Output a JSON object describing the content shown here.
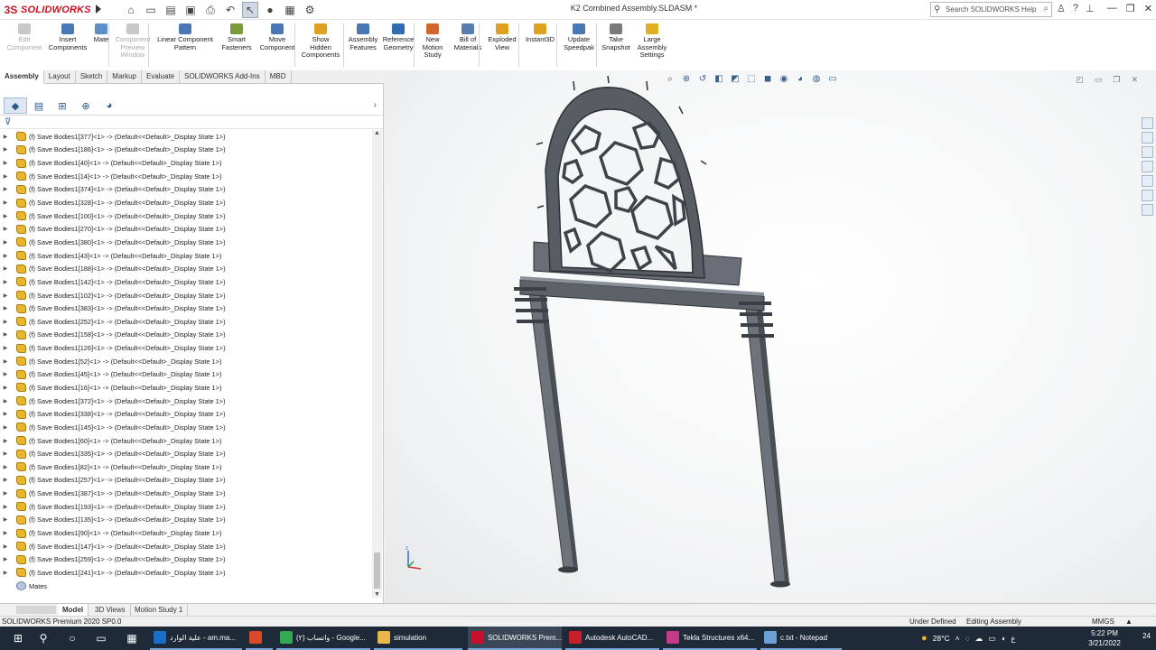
{
  "app": {
    "logo_mark": "3S",
    "logo_text": "SOLIDWORKS",
    "document_title": "K2 Combined Assembly.SLDASM *",
    "search_placeholder": "Search SOLIDWORKS Help"
  },
  "quick_access": [
    "home-icon",
    "new-icon",
    "open-icon",
    "save-icon",
    "print-icon",
    "undo-icon",
    "select-icon",
    "rebuild-icon",
    "file-props-icon",
    "options-icon"
  ],
  "command_manager": [
    {
      "label": "Edit\nComponent",
      "disabled": true,
      "color": "#c8c8c8"
    },
    {
      "label": "Insert\nComponents",
      "disabled": false,
      "color": "#4a78b5"
    },
    {
      "label": "Mate",
      "disabled": false,
      "color": "#5a8fc7"
    },
    {
      "label": "Component\nPreview\nWindow",
      "disabled": true,
      "color": "#c8c8c8"
    },
    {
      "label": "Linear Component\nPattern",
      "disabled": false,
      "color": "#4a78b5"
    },
    {
      "label": "Smart\nFasteners",
      "disabled": false,
      "color": "#7a9a3b"
    },
    {
      "label": "Move\nComponent",
      "disabled": false,
      "color": "#4a78b5"
    },
    {
      "label": "Show\nHidden\nComponents",
      "disabled": false,
      "color": "#e0a020"
    },
    {
      "label": "Assembly\nFeatures",
      "disabled": false,
      "color": "#4a78b5"
    },
    {
      "label": "Reference\nGeometry",
      "disabled": false,
      "color": "#2f6cb0"
    },
    {
      "label": "New\nMotion\nStudy",
      "disabled": false,
      "color": "#d0662a"
    },
    {
      "label": "Bill of\nMaterials",
      "disabled": false,
      "color": "#5a7db0"
    },
    {
      "label": "Exploded\nView",
      "disabled": false,
      "color": "#e0a020"
    },
    {
      "label": "Instant3D",
      "disabled": false,
      "color": "#e0a020"
    },
    {
      "label": "Update\nSpeedpak",
      "disabled": false,
      "color": "#4a78b5"
    },
    {
      "label": "Take\nSnapshot",
      "disabled": false,
      "color": "#7a7a7a"
    },
    {
      "label": "Large\nAssembly\nSettings",
      "disabled": false,
      "color": "#e0b020"
    }
  ],
  "command_tabs": [
    "Assembly",
    "Layout",
    "Sketch",
    "Markup",
    "Evaluate",
    "SOLIDWORKS Add-Ins",
    "MBD"
  ],
  "active_command_tab": "Assembly",
  "tree": {
    "items": [
      "(f) Save Bodies1[377]<1> -> (Default<<Default>_Display State 1>)",
      "(f) Save Bodies1[186]<1> -> (Default<<Default>_Display State 1>)",
      "(f) Save Bodies1[40]<1> -> (Default<<Default>_Display State 1>)",
      "(f) Save Bodies1[14]<1> -> (Default<<Default>_Display State 1>)",
      "(f) Save Bodies1[374]<1> -> (Default<<Default>_Display State 1>)",
      "(f) Save Bodies1[328]<1> -> (Default<<Default>_Display State 1>)",
      "(f) Save Bodies1[100]<1> -> (Default<<Default>_Display State 1>)",
      "(f) Save Bodies1[270]<1> -> (Default<<Default>_Display State 1>)",
      "(f) Save Bodies1[380]<1> -> (Default<<Default>_Display State 1>)",
      "(f) Save Bodies1[43]<1> -> (Default<<Default>_Display State 1>)",
      "(f) Save Bodies1[188]<1> -> (Default<<Default>_Display State 1>)",
      "(f) Save Bodies1[142]<1> -> (Default<<Default>_Display State 1>)",
      "(f) Save Bodies1[102]<1> -> (Default<<Default>_Display State 1>)",
      "(f) Save Bodies1[383]<1> -> (Default<<Default>_Display State 1>)",
      "(f) Save Bodies1[252]<1> -> (Default<<Default>_Display State 1>)",
      "(f) Save Bodies1[158]<1> -> (Default<<Default>_Display State 1>)",
      "(f) Save Bodies1[126]<1> -> (Default<<Default>_Display State 1>)",
      "(f) Save Bodies1[52]<1> -> (Default<<Default>_Display State 1>)",
      "(f) Save Bodies1[45]<1> -> (Default<<Default>_Display State 1>)",
      "(f) Save Bodies1[16]<1> -> (Default<<Default>_Display State 1>)",
      "(f) Save Bodies1[372]<1> -> (Default<<Default>_Display State 1>)",
      "(f) Save Bodies1[338]<1> -> (Default<<Default>_Display State 1>)",
      "(f) Save Bodies1[145]<1> -> (Default<<Default>_Display State 1>)",
      "(f) Save Bodies1[60]<1> -> (Default<<Default>_Display State 1>)",
      "(f) Save Bodies1[335]<1> -> (Default<<Default>_Display State 1>)",
      "(f) Save Bodies1[82]<1> -> (Default<<Default>_Display State 1>)",
      "(f) Save Bodies1[257]<1> -> (Default<<Default>_Display State 1>)",
      "(f) Save Bodies1[387]<1> -> (Default<<Default>_Display State 1>)",
      "(f) Save Bodies1[193]<1> -> (Default<<Default>_Display State 1>)",
      "(f) Save Bodies1[135]<1> -> (Default<<Default>_Display State 1>)",
      "(f) Save Bodies1[90]<1> -> (Default<<Default>_Display State 1>)",
      "(f) Save Bodies1[147]<1> -> (Default<<Default>_Display State 1>)",
      "(f) Save Bodies1[259]<1> -> (Default<<Default>_Display State 1>)",
      "(f) Save Bodies1[241]<1> -> (Default<<Default>_Display State 1>)"
    ],
    "mates_label": "Mates"
  },
  "bottom_tabs": [
    "Model",
    "3D Views",
    "Motion Study 1"
  ],
  "active_bottom_tab": "Model",
  "status": {
    "product": "SOLIDWORKS Premium 2020 SP0.0",
    "under_defined": "Under Defined",
    "editing": "Editing Assembly",
    "units": "MMGS",
    "units_arrow": "▲"
  },
  "taskbar": {
    "apps": [
      {
        "label": "علية الوارد - am.ma...",
        "color": "#1a6fc9",
        "active": false
      },
      {
        "label": "",
        "color": "#d84a2a",
        "active": false
      },
      {
        "label": "واتساب (٢) - Google...",
        "color": "#34a853",
        "active": false
      },
      {
        "label": "simulation",
        "color": "#e8b84a",
        "active": false
      },
      {
        "label": "SOLIDWORKS Prem...",
        "color": "#c8102e",
        "active": true
      },
      {
        "label": "Autodesk AutoCAD...",
        "color": "#c8202a",
        "active": false
      },
      {
        "label": "Tekla Structures x64...",
        "color": "#c63a8a",
        "active": false
      },
      {
        "label": "c.txt - Notepad",
        "color": "#6aa0d8",
        "active": false
      }
    ],
    "temperature": "28°C",
    "lang": "ع",
    "time": "5:22 PM",
    "date": "3/21/2022",
    "notif_count": "24"
  },
  "colors": {
    "accent": "#d0101e",
    "steel_dark": "#4a4e55",
    "steel_mid": "#6e737b",
    "steel_light": "#9aa0a8"
  }
}
